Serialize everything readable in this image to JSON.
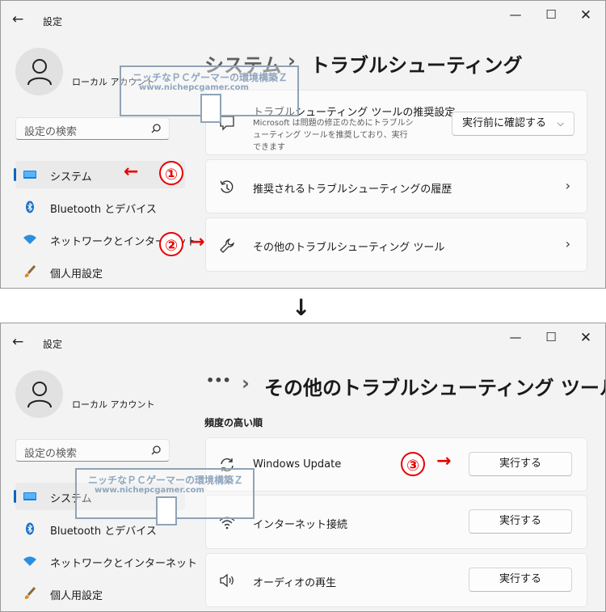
{
  "top_window": {
    "app_title": "設定",
    "user": "ローカル アカウント",
    "search_placeholder": "設定の検索",
    "nav": [
      {
        "label": "システム",
        "icon": "display-icon"
      },
      {
        "label": "Bluetooth とデバイス",
        "icon": "bluetooth-icon"
      },
      {
        "label": "ネットワークとインターネット",
        "icon": "wifi-icon"
      },
      {
        "label": "個人用設定",
        "icon": "brush-icon"
      }
    ],
    "breadcrumb_parent": "システム",
    "breadcrumb_sep": "›",
    "breadcrumb_current": "トラブルシューティング",
    "cards": [
      {
        "title": "トラブルシューティング ツールの推奨設定",
        "desc": "Microsoft は問題の修正のためにトラブルシューティング ツールを推奨しており、実行できます",
        "dropdown": "実行前に確認する"
      },
      {
        "title": "推奨されるトラブルシューティングの履歴"
      },
      {
        "title": "その他のトラブルシューティング ツール"
      }
    ]
  },
  "bottom_window": {
    "app_title": "設定",
    "user": "ローカル アカウント",
    "search_placeholder": "設定の検索",
    "nav": [
      {
        "label": "システム"
      },
      {
        "label": "Bluetooth とデバイス"
      },
      {
        "label": "ネットワークとインターネット"
      },
      {
        "label": "個人用設定"
      }
    ],
    "breadcrumb_ellipsis": "•••",
    "breadcrumb_sep": "›",
    "breadcrumb_current": "その他のトラブルシューティング ツール",
    "section_title": "頻度の高い順",
    "items": [
      {
        "title": "Windows Update",
        "button": "実行する"
      },
      {
        "title": "インターネット接続",
        "button": "実行する"
      },
      {
        "title": "オーディオの再生",
        "button": "実行する"
      }
    ]
  },
  "annotations": {
    "step1": "①",
    "step2": "②",
    "step3": "③",
    "down_arrow": "↓"
  },
  "watermark": {
    "line1": "ニッチなＰＣゲーマーの環境構築Ｚ",
    "line2": "www.nichepcgamer.com"
  },
  "accent_color": "#0067c0",
  "annotation_color": "#e60000"
}
